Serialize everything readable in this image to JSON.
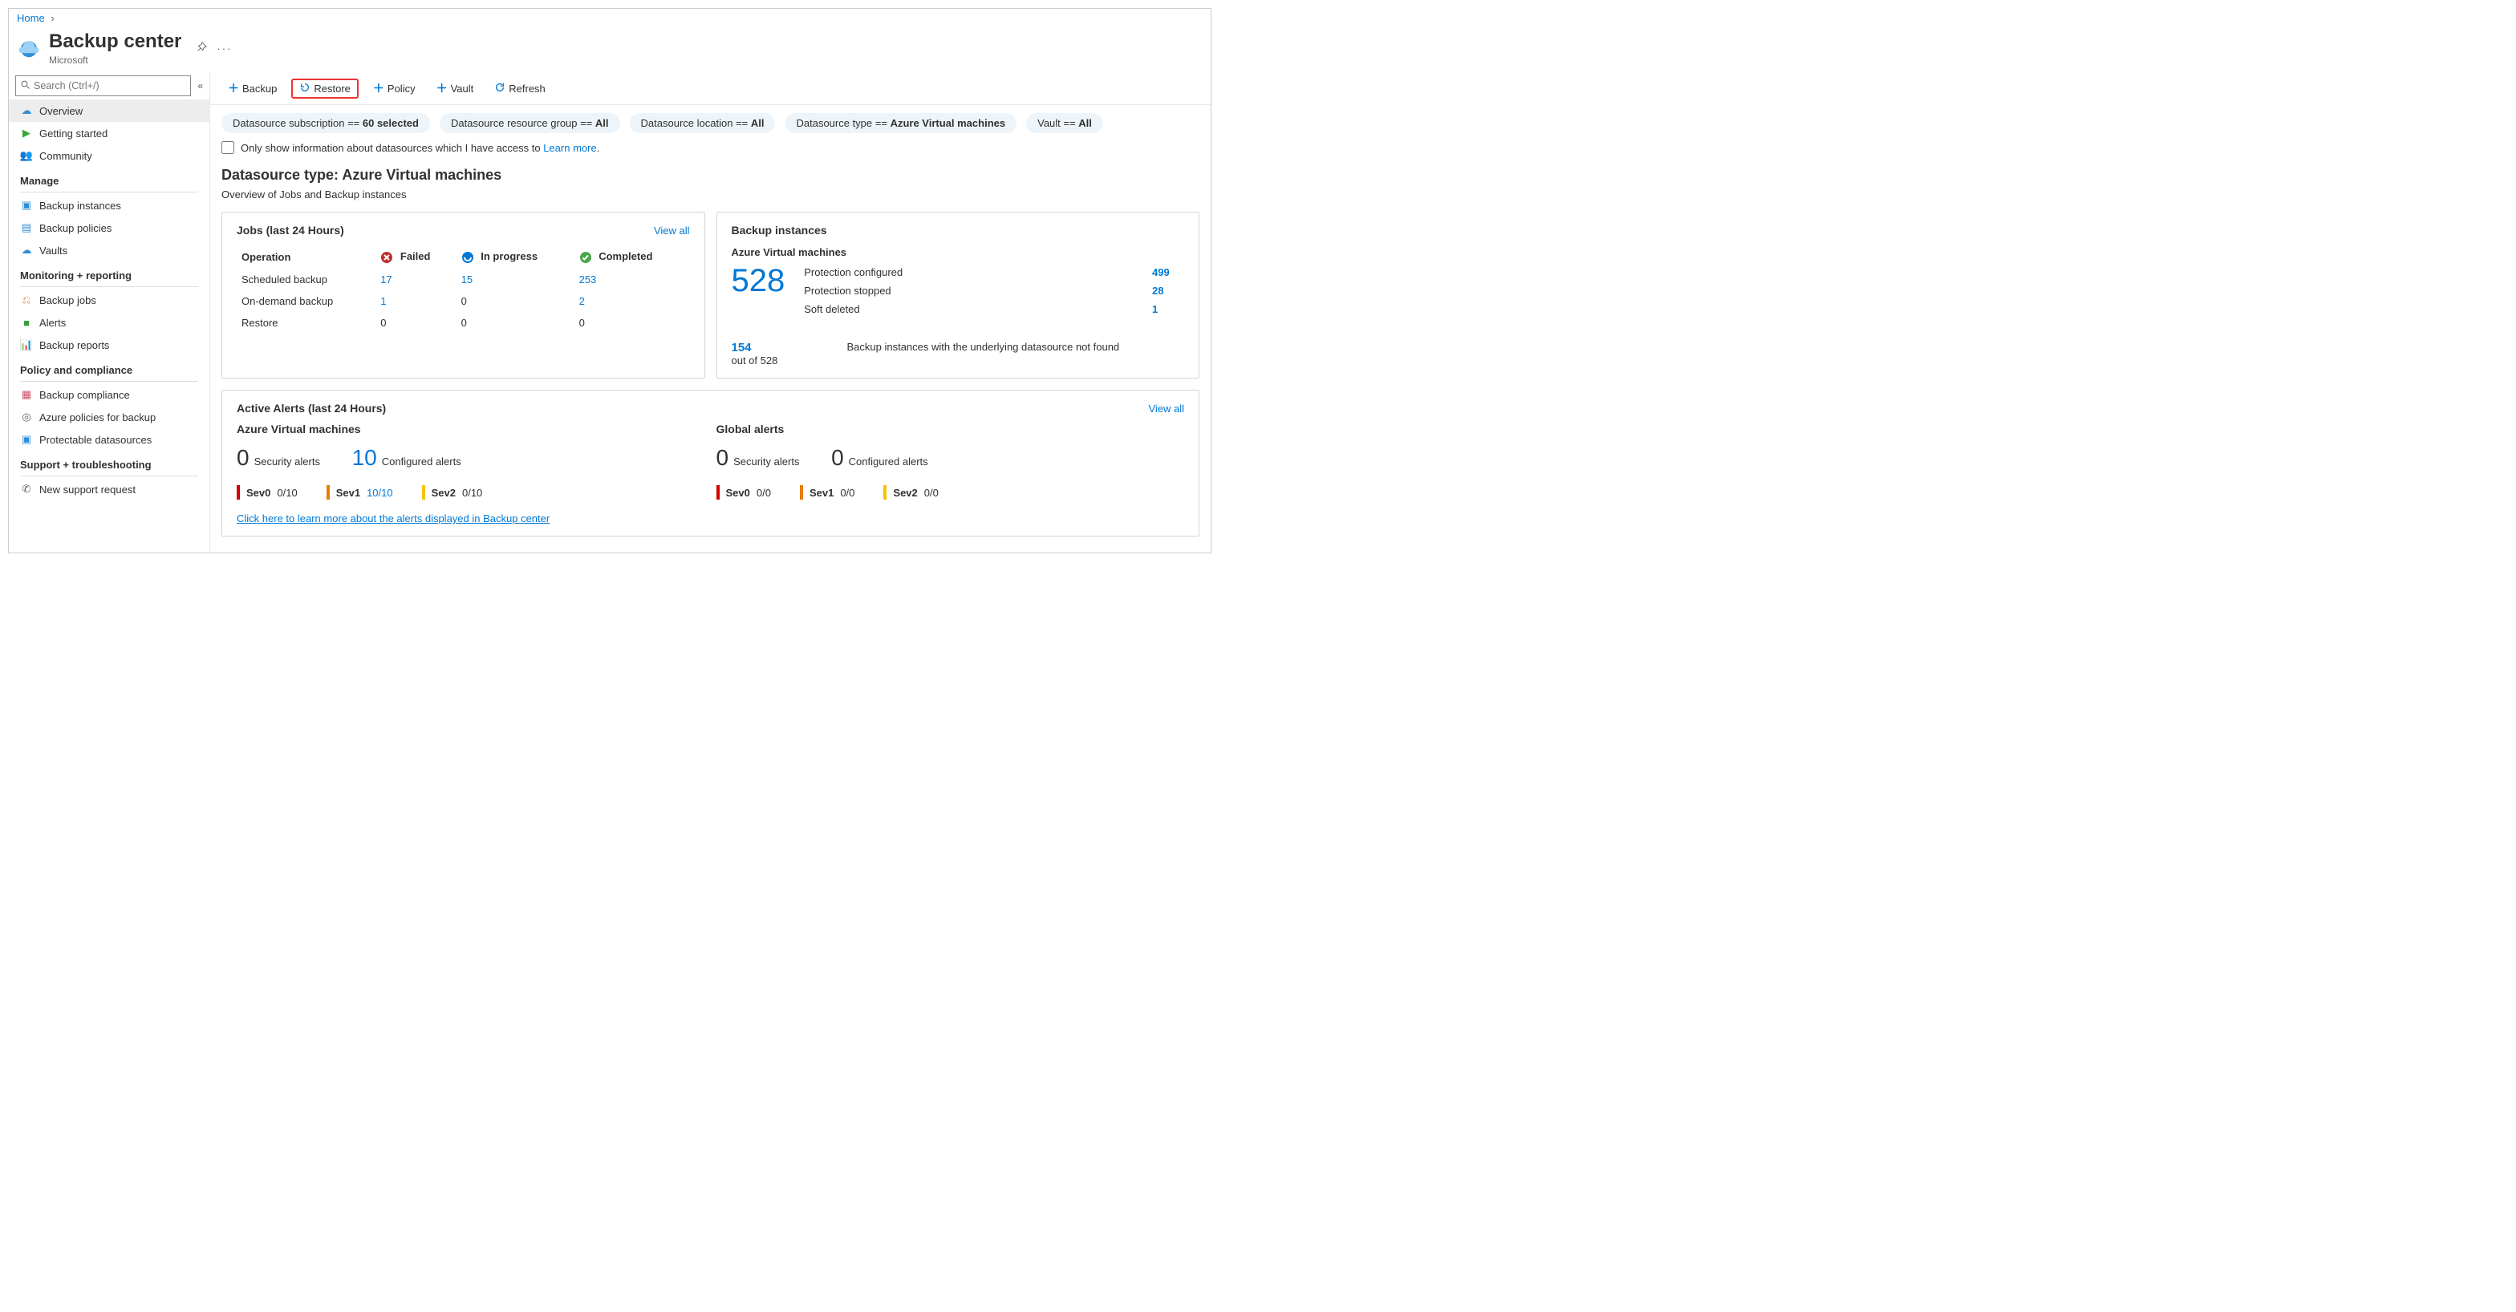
{
  "breadcrumb": {
    "home": "Home"
  },
  "header": {
    "title": "Backup center",
    "subtitle": "Microsoft"
  },
  "sidebar": {
    "search_placeholder": "Search (Ctrl+/)",
    "overview": "Overview",
    "getting_started": "Getting started",
    "community": "Community",
    "manage_label": "Manage",
    "backup_instances": "Backup instances",
    "backup_policies": "Backup policies",
    "vaults": "Vaults",
    "monitoring_label": "Monitoring + reporting",
    "backup_jobs": "Backup jobs",
    "alerts": "Alerts",
    "backup_reports": "Backup reports",
    "policy_label": "Policy and compliance",
    "backup_compliance": "Backup compliance",
    "azure_policies": "Azure policies for backup",
    "protectable": "Protectable datasources",
    "support_label": "Support + troubleshooting",
    "new_support": "New support request"
  },
  "toolbar": {
    "backup": "Backup",
    "restore": "Restore",
    "policy": "Policy",
    "vault": "Vault",
    "refresh": "Refresh"
  },
  "filters": {
    "sub_label": "Datasource subscription == ",
    "sub_val": "60 selected",
    "rg_label": "Datasource resource group == ",
    "rg_val": "All",
    "loc_label": "Datasource location == ",
    "loc_val": "All",
    "type_label": "Datasource type == ",
    "type_val": "Azure Virtual machines",
    "vault_label": "Vault == ",
    "vault_val": "All"
  },
  "checkline": {
    "text": "Only show information about datasources which I have access to ",
    "link": "Learn more"
  },
  "ds": {
    "title": "Datasource type: Azure Virtual machines",
    "subtitle": "Overview of Jobs and Backup instances"
  },
  "jobs_card": {
    "title": "Jobs (last 24 Hours)",
    "view_all": "View all",
    "operation": "Operation",
    "failed": "Failed",
    "inprogress": "In progress",
    "completed": "Completed",
    "rows": {
      "scheduled": {
        "name": "Scheduled backup",
        "failed": "17",
        "inprogress": "15",
        "completed": "253"
      },
      "ondemand": {
        "name": "On-demand backup",
        "failed": "1",
        "inprogress": "0",
        "completed": "2"
      },
      "restore": {
        "name": "Restore",
        "failed": "0",
        "inprogress": "0",
        "completed": "0"
      }
    }
  },
  "bi_card": {
    "title": "Backup instances",
    "subtitle": "Azure Virtual machines",
    "total": "528",
    "protection_configured_label": "Protection configured",
    "protection_configured_val": "499",
    "protection_stopped_label": "Protection stopped",
    "protection_stopped_val": "28",
    "soft_deleted_label": "Soft deleted",
    "soft_deleted_val": "1",
    "notfound_count": "154",
    "notfound_out": "out of 528",
    "notfound_text": "Backup instances with the underlying datasource not found"
  },
  "alerts_card": {
    "title": "Active Alerts (last 24 Hours)",
    "view_all": "View all",
    "avm_label": "Azure Virtual machines",
    "global_label": "Global alerts",
    "security_label": "Security alerts",
    "configured_label": "Configured alerts",
    "avm_security": "0",
    "avm_configured": "10",
    "global_security": "0",
    "global_configured": "0",
    "sev0": "Sev0",
    "sev1": "Sev1",
    "sev2": "Sev2",
    "avm_s0": "0/10",
    "avm_s1": "10/10",
    "avm_s2": "0/10",
    "gl_s0": "0/0",
    "gl_s1": "0/0",
    "gl_s2": "0/0",
    "learn": "Click here to learn more about the alerts displayed in Backup center"
  }
}
